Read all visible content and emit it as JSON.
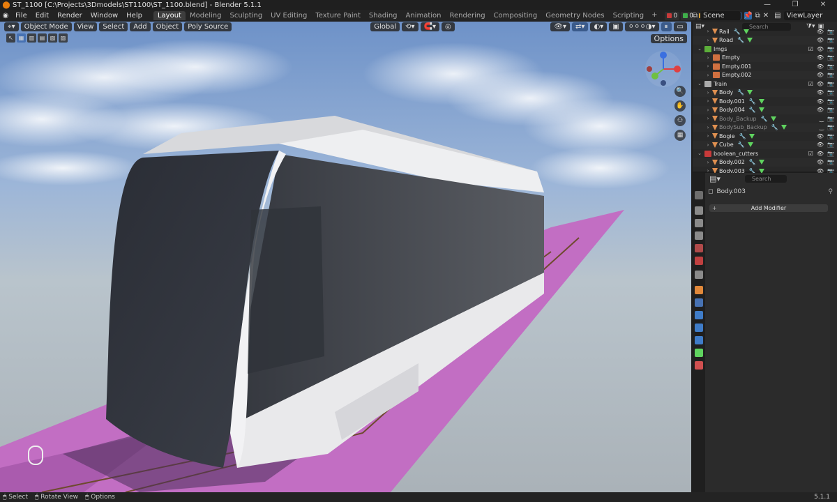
{
  "window": {
    "title": "ST_1100 [C:\\Projects\\3Dmodels\\ST1100\\ST_1100.blend] - Blender 5.1.1",
    "controls": [
      "—",
      "❐",
      "✕"
    ]
  },
  "menu": [
    "File",
    "Edit",
    "Render",
    "Window",
    "Help"
  ],
  "workspaces": [
    {
      "label": "Layout",
      "active": true
    },
    {
      "label": "Modeling",
      "active": false
    },
    {
      "label": "Sculpting",
      "active": false
    },
    {
      "label": "UV Editing",
      "active": false
    },
    {
      "label": "Texture Paint",
      "active": false
    },
    {
      "label": "Shading",
      "active": false
    },
    {
      "label": "Animation",
      "active": false
    },
    {
      "label": "Rendering",
      "active": false
    },
    {
      "label": "Compositing",
      "active": false
    },
    {
      "label": "Geometry Nodes",
      "active": false
    },
    {
      "label": "Scripting",
      "active": false
    }
  ],
  "status_counts": {
    "errors": "0",
    "warnings": "0",
    "info": "0"
  },
  "scene": {
    "name": "Scene",
    "view_layer": "ViewLayer"
  },
  "viewport_header": {
    "mode": "Object Mode",
    "view": "View",
    "select": "Select",
    "add": "Add",
    "object": "Object",
    "source": "Poly Source",
    "transform": "Global",
    "options": "Options"
  },
  "outliner": {
    "search_placeholder": "Search",
    "rows": [
      {
        "name": "Rail",
        "indent": 1,
        "type": "object",
        "dim": false
      },
      {
        "name": "Road",
        "indent": 1,
        "type": "object",
        "dim": false
      },
      {
        "name": "Imgs",
        "indent": 0,
        "type": "collection",
        "dim": false
      },
      {
        "name": "Empty",
        "indent": 1,
        "type": "empty",
        "dim": false
      },
      {
        "name": "Empty.001",
        "indent": 1,
        "type": "empty",
        "dim": false
      },
      {
        "name": "Empty.002",
        "indent": 1,
        "type": "empty",
        "dim": false
      },
      {
        "name": "Train",
        "indent": 0,
        "type": "collection",
        "dim": false
      },
      {
        "name": "Body",
        "indent": 1,
        "type": "object",
        "dim": false
      },
      {
        "name": "Body.001",
        "indent": 1,
        "type": "object",
        "dim": false
      },
      {
        "name": "Body.004",
        "indent": 1,
        "type": "object",
        "dim": false
      },
      {
        "name": "Body_Backup",
        "indent": 1,
        "type": "object",
        "dim": true
      },
      {
        "name": "BodySub_Backup",
        "indent": 1,
        "type": "object",
        "dim": true
      },
      {
        "name": "Bogie",
        "indent": 1,
        "type": "object",
        "dim": false
      },
      {
        "name": "Cube",
        "indent": 1,
        "type": "object",
        "dim": false
      },
      {
        "name": "boolean_cutters",
        "indent": 0,
        "type": "collection-red",
        "dim": false
      },
      {
        "name": "Body.002",
        "indent": 1,
        "type": "object",
        "dim": false
      },
      {
        "name": "Body.003",
        "indent": 1,
        "type": "object",
        "dim": false
      }
    ]
  },
  "properties": {
    "search_placeholder": "Search",
    "object_name": "Body.003",
    "add_modifier": "Add Modifier"
  },
  "statusbar": {
    "select": "Select",
    "rotate": "Rotate View",
    "options": "Options",
    "version": "5.1.1"
  },
  "colors": {
    "accent": "#4772b3",
    "road": "#c36bc6",
    "sky": "#8eadd6"
  }
}
